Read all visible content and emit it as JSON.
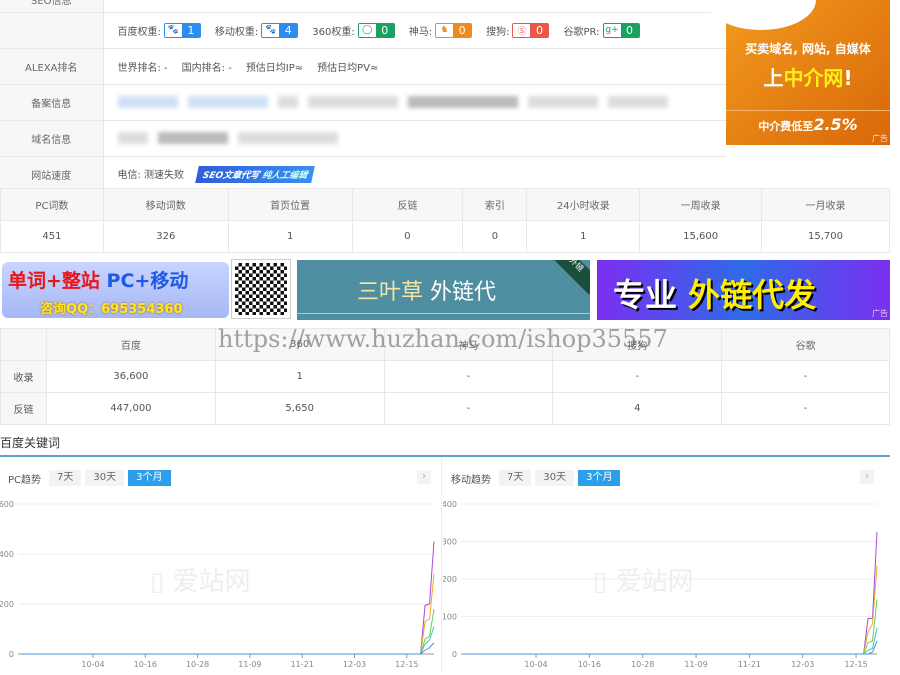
{
  "info": {
    "seo_label": "SEO信息",
    "weights": [
      {
        "label": "百度权重:",
        "value": "1",
        "icon": "baidu-paw-icon",
        "color": "#2d8cf0"
      },
      {
        "label": "移动权重:",
        "value": "4",
        "icon": "baidu-mobile-paw-icon",
        "color": "#2d8cf0"
      },
      {
        "label": "360权重:",
        "value": "0",
        "icon": "360-icon",
        "color": "#19a15f"
      },
      {
        "label": "神马:",
        "value": "0",
        "icon": "shenma-icon",
        "color": "#f08a1d"
      },
      {
        "label": "搜狗:",
        "value": "0",
        "icon": "sogou-icon",
        "color": "#e9564a"
      },
      {
        "label": "谷歌PR:",
        "value": "0",
        "icon": "google-plus-icon",
        "color": "#19a15f"
      }
    ],
    "alexa_label": "ALEXA排名",
    "alexa": [
      "世界排名: -",
      "国内排名: -",
      "预估日均IP≈",
      "预估日均PV≈"
    ],
    "beian_label": "备案信息",
    "domain_label": "域名信息",
    "speed_label": "网站速度",
    "speed_value": "电信: 测速失败",
    "speed_ad": [
      "SEO文章代写",
      "纯人工编辑"
    ]
  },
  "right_ad": {
    "line1": "买卖域名, 网站, 自媒体",
    "line2a": "上",
    "line2b": "中介网",
    "line2c": "!",
    "line3": "中介费低至",
    "rate": "2.5%",
    "tag": "广告"
  },
  "stats": {
    "headers": [
      "PC词数",
      "移动词数",
      "首页位置",
      "反链",
      "索引",
      "24小时收录",
      "一周收录",
      "一月收录"
    ],
    "values": [
      "451",
      "326",
      "1",
      "0",
      "0",
      "1",
      "15,600",
      "15,700"
    ]
  },
  "banners": {
    "b1_line1a": "单词+整站",
    "b1_line1b": "PC+移动",
    "b1_line2": "咨询QQ：695354360",
    "b2_text_a": "三叶草",
    "b2_text_b": "外链代",
    "b2_corner": "外链",
    "b3_text_a": "专业",
    "b3_text_b": "外链代发",
    "tag": "广告"
  },
  "engines": {
    "headers": [
      "",
      "百度",
      "360",
      "神马",
      "搜狗",
      "谷歌"
    ],
    "rows": [
      [
        "收录",
        "36,600",
        "1",
        "-",
        "-",
        "-"
      ],
      [
        "反链",
        "447,000",
        "5,650",
        "-",
        "4",
        "-"
      ]
    ],
    "watermark": "https://www.huzhan.com/ishop35557"
  },
  "keywords_title": "百度关键词",
  "chart_tabs": [
    "7天",
    "30天",
    "3个月"
  ],
  "chart_data": [
    {
      "type": "line",
      "title": "PC趋势",
      "ylim": [
        0,
        600
      ],
      "yticks": [
        0,
        200,
        400,
        600
      ],
      "xticks": [
        "10-04",
        "10-16",
        "10-28",
        "11-09",
        "11-21",
        "12-03",
        "12-15"
      ],
      "watermark": "爱站网",
      "zero_days_before": 89,
      "series": [
        {
          "color": "#a84ad8",
          "values": [
            0,
            195,
            200,
            450
          ]
        },
        {
          "color": "#f5a623",
          "values": [
            0,
            130,
            140,
            320
          ]
        },
        {
          "color": "#5fd35f",
          "values": [
            0,
            60,
            70,
            180
          ]
        },
        {
          "color": "#3cc8b4",
          "values": [
            0,
            40,
            55,
            110
          ]
        },
        {
          "color": "#4a90e2",
          "values": [
            0,
            15,
            25,
            45
          ]
        }
      ]
    },
    {
      "type": "line",
      "title": "移动趋势",
      "ylim": [
        0,
        400
      ],
      "yticks": [
        0,
        100,
        200,
        300,
        400
      ],
      "xticks": [
        "10-04",
        "10-16",
        "10-28",
        "11-09",
        "11-21",
        "12-03",
        "12-15"
      ],
      "watermark": "爱站网",
      "zero_days_before": 89,
      "series": [
        {
          "color": "#a84ad8",
          "values": [
            0,
            95,
            95,
            325
          ]
        },
        {
          "color": "#f5a623",
          "values": [
            0,
            60,
            80,
            235
          ]
        },
        {
          "color": "#5fd35f",
          "values": [
            0,
            30,
            35,
            145
          ]
        },
        {
          "color": "#3cc8b4",
          "values": [
            0,
            10,
            15,
            70
          ]
        },
        {
          "color": "#4a90e2",
          "values": [
            0,
            0,
            5,
            35
          ]
        }
      ]
    }
  ]
}
